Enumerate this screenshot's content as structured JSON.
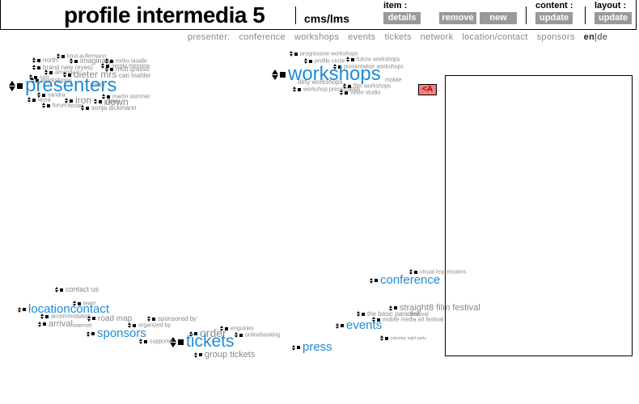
{
  "header": {
    "title": "profile intermedia 5",
    "subtitle": "cms/lms",
    "item": {
      "label": "item :",
      "details": "details",
      "remove": "remove",
      "new": "new"
    },
    "content": {
      "label": "content :",
      "update": "update"
    },
    "layout": {
      "label": "layout :",
      "update": "update"
    }
  },
  "nav": {
    "items": [
      "presenter:",
      "conference",
      "workshops",
      "events",
      "tickets",
      "network",
      "location/contact",
      "sponsors"
    ],
    "lang": {
      "en": "en",
      "sep": "|",
      "de": "de"
    }
  },
  "collapse_button": "<A",
  "nodes": {
    "presenters": {
      "main": "presenters",
      "sub": [
        "knut aufermann",
        "north",
        "imaginary",
        "mirko lasalle",
        "brand new (eyes)",
        "sergio messina",
        "mutt grasso",
        "dieter mrs",
        "amanda",
        "cari mahler",
        "workshops",
        "sun",
        "radio",
        "iron",
        "jones",
        "down",
        "laura",
        "sandra",
        "forum",
        "florian",
        "sonja dickmann",
        "martin sommer"
      ]
    },
    "workshops": {
      "main": "workshops",
      "sub": [
        "progressive workshops",
        "profile circle",
        "future workshops",
        "presentation workshops",
        "dirty workshops",
        "ptn",
        "web",
        "film workshops",
        "workshop presentation",
        "video studio",
        "mobile"
      ]
    },
    "conference": {
      "main": "conference",
      "sub": [
        "visual impressions"
      ]
    },
    "straight8": "straight8 film festival",
    "events": {
      "main": "events",
      "sub": [
        "the basic paradise",
        "festival",
        "mobile media art festival",
        "saturday night party"
      ]
    },
    "press": "press",
    "tickets": {
      "main": "tickets",
      "order": "order",
      "group": "group tickets",
      "sub": [
        "enquiries",
        "onlinebooking",
        "supporter",
        "organized by"
      ]
    },
    "sponsors": {
      "main": "sponsors",
      "sub": [
        "sponsored by"
      ]
    },
    "location": {
      "main": "locationcontact",
      "contact_us": "contact us",
      "road_map": "road map",
      "arrival": "arrival",
      "sub": [
        "team",
        "accommodation",
        "internet"
      ]
    }
  }
}
